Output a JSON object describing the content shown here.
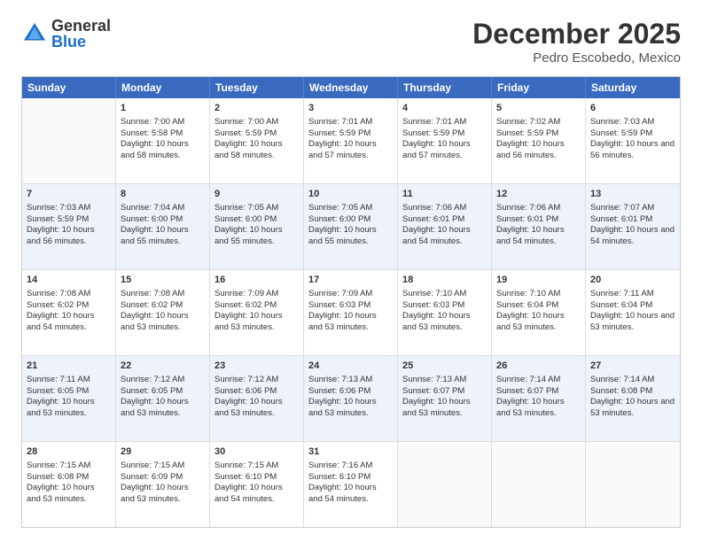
{
  "header": {
    "logo_general": "General",
    "logo_blue": "Blue",
    "title": "December 2025",
    "subtitle": "Pedro Escobedo, Mexico"
  },
  "weekdays": [
    "Sunday",
    "Monday",
    "Tuesday",
    "Wednesday",
    "Thursday",
    "Friday",
    "Saturday"
  ],
  "rows": [
    {
      "bg": "light",
      "cells": [
        {
          "day": "",
          "empty": true
        },
        {
          "day": "1",
          "sunrise": "Sunrise: 7:00 AM",
          "sunset": "Sunset: 5:58 PM",
          "daylight": "Daylight: 10 hours and 58 minutes."
        },
        {
          "day": "2",
          "sunrise": "Sunrise: 7:00 AM",
          "sunset": "Sunset: 5:59 PM",
          "daylight": "Daylight: 10 hours and 58 minutes."
        },
        {
          "day": "3",
          "sunrise": "Sunrise: 7:01 AM",
          "sunset": "Sunset: 5:59 PM",
          "daylight": "Daylight: 10 hours and 57 minutes."
        },
        {
          "day": "4",
          "sunrise": "Sunrise: 7:01 AM",
          "sunset": "Sunset: 5:59 PM",
          "daylight": "Daylight: 10 hours and 57 minutes."
        },
        {
          "day": "5",
          "sunrise": "Sunrise: 7:02 AM",
          "sunset": "Sunset: 5:59 PM",
          "daylight": "Daylight: 10 hours and 56 minutes."
        },
        {
          "day": "6",
          "sunrise": "Sunrise: 7:03 AM",
          "sunset": "Sunset: 5:59 PM",
          "daylight": "Daylight: 10 hours and 56 minutes."
        }
      ]
    },
    {
      "bg": "alt",
      "cells": [
        {
          "day": "7",
          "sunrise": "Sunrise: 7:03 AM",
          "sunset": "Sunset: 5:59 PM",
          "daylight": "Daylight: 10 hours and 56 minutes."
        },
        {
          "day": "8",
          "sunrise": "Sunrise: 7:04 AM",
          "sunset": "Sunset: 6:00 PM",
          "daylight": "Daylight: 10 hours and 55 minutes."
        },
        {
          "day": "9",
          "sunrise": "Sunrise: 7:05 AM",
          "sunset": "Sunset: 6:00 PM",
          "daylight": "Daylight: 10 hours and 55 minutes."
        },
        {
          "day": "10",
          "sunrise": "Sunrise: 7:05 AM",
          "sunset": "Sunset: 6:00 PM",
          "daylight": "Daylight: 10 hours and 55 minutes."
        },
        {
          "day": "11",
          "sunrise": "Sunrise: 7:06 AM",
          "sunset": "Sunset: 6:01 PM",
          "daylight": "Daylight: 10 hours and 54 minutes."
        },
        {
          "day": "12",
          "sunrise": "Sunrise: 7:06 AM",
          "sunset": "Sunset: 6:01 PM",
          "daylight": "Daylight: 10 hours and 54 minutes."
        },
        {
          "day": "13",
          "sunrise": "Sunrise: 7:07 AM",
          "sunset": "Sunset: 6:01 PM",
          "daylight": "Daylight: 10 hours and 54 minutes."
        }
      ]
    },
    {
      "bg": "light",
      "cells": [
        {
          "day": "14",
          "sunrise": "Sunrise: 7:08 AM",
          "sunset": "Sunset: 6:02 PM",
          "daylight": "Daylight: 10 hours and 54 minutes."
        },
        {
          "day": "15",
          "sunrise": "Sunrise: 7:08 AM",
          "sunset": "Sunset: 6:02 PM",
          "daylight": "Daylight: 10 hours and 53 minutes."
        },
        {
          "day": "16",
          "sunrise": "Sunrise: 7:09 AM",
          "sunset": "Sunset: 6:02 PM",
          "daylight": "Daylight: 10 hours and 53 minutes."
        },
        {
          "day": "17",
          "sunrise": "Sunrise: 7:09 AM",
          "sunset": "Sunset: 6:03 PM",
          "daylight": "Daylight: 10 hours and 53 minutes."
        },
        {
          "day": "18",
          "sunrise": "Sunrise: 7:10 AM",
          "sunset": "Sunset: 6:03 PM",
          "daylight": "Daylight: 10 hours and 53 minutes."
        },
        {
          "day": "19",
          "sunrise": "Sunrise: 7:10 AM",
          "sunset": "Sunset: 6:04 PM",
          "daylight": "Daylight: 10 hours and 53 minutes."
        },
        {
          "day": "20",
          "sunrise": "Sunrise: 7:11 AM",
          "sunset": "Sunset: 6:04 PM",
          "daylight": "Daylight: 10 hours and 53 minutes."
        }
      ]
    },
    {
      "bg": "alt",
      "cells": [
        {
          "day": "21",
          "sunrise": "Sunrise: 7:11 AM",
          "sunset": "Sunset: 6:05 PM",
          "daylight": "Daylight: 10 hours and 53 minutes."
        },
        {
          "day": "22",
          "sunrise": "Sunrise: 7:12 AM",
          "sunset": "Sunset: 6:05 PM",
          "daylight": "Daylight: 10 hours and 53 minutes."
        },
        {
          "day": "23",
          "sunrise": "Sunrise: 7:12 AM",
          "sunset": "Sunset: 6:06 PM",
          "daylight": "Daylight: 10 hours and 53 minutes."
        },
        {
          "day": "24",
          "sunrise": "Sunrise: 7:13 AM",
          "sunset": "Sunset: 6:06 PM",
          "daylight": "Daylight: 10 hours and 53 minutes."
        },
        {
          "day": "25",
          "sunrise": "Sunrise: 7:13 AM",
          "sunset": "Sunset: 6:07 PM",
          "daylight": "Daylight: 10 hours and 53 minutes."
        },
        {
          "day": "26",
          "sunrise": "Sunrise: 7:14 AM",
          "sunset": "Sunset: 6:07 PM",
          "daylight": "Daylight: 10 hours and 53 minutes."
        },
        {
          "day": "27",
          "sunrise": "Sunrise: 7:14 AM",
          "sunset": "Sunset: 6:08 PM",
          "daylight": "Daylight: 10 hours and 53 minutes."
        }
      ]
    },
    {
      "bg": "light",
      "cells": [
        {
          "day": "28",
          "sunrise": "Sunrise: 7:15 AM",
          "sunset": "Sunset: 6:08 PM",
          "daylight": "Daylight: 10 hours and 53 minutes."
        },
        {
          "day": "29",
          "sunrise": "Sunrise: 7:15 AM",
          "sunset": "Sunset: 6:09 PM",
          "daylight": "Daylight: 10 hours and 53 minutes."
        },
        {
          "day": "30",
          "sunrise": "Sunrise: 7:15 AM",
          "sunset": "Sunset: 6:10 PM",
          "daylight": "Daylight: 10 hours and 54 minutes."
        },
        {
          "day": "31",
          "sunrise": "Sunrise: 7:16 AM",
          "sunset": "Sunset: 6:10 PM",
          "daylight": "Daylight: 10 hours and 54 minutes."
        },
        {
          "day": "",
          "empty": true
        },
        {
          "day": "",
          "empty": true
        },
        {
          "day": "",
          "empty": true
        }
      ]
    }
  ]
}
